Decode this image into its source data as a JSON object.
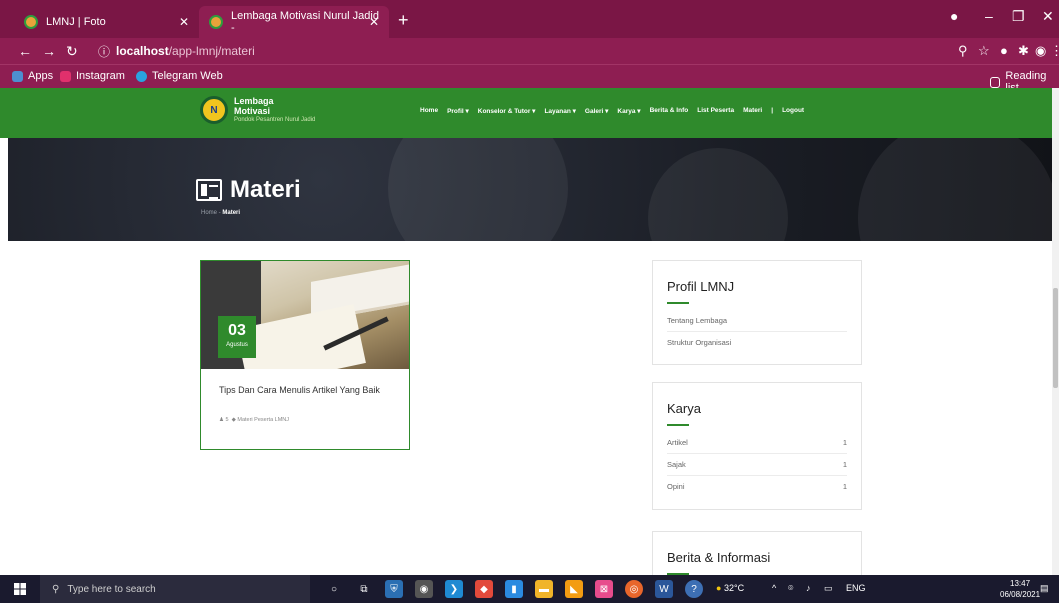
{
  "browser": {
    "tabs": [
      {
        "label": "LMNJ | Foto",
        "active": false
      },
      {
        "label": "Lembaga Motivasi Nurul Jadid - ",
        "active": true
      }
    ],
    "url_host": "localhost",
    "url_path": "/app-lmnj/materi",
    "bookmarks": [
      {
        "label": "Apps",
        "icon": "apps-grid-icon"
      },
      {
        "label": "Instagram",
        "icon": "instagram-icon"
      },
      {
        "label": "Telegram Web",
        "icon": "telegram-icon"
      }
    ],
    "reading_list": "Reading list",
    "colors": {
      "frame": "#7a1645",
      "active_tab": "#8e1e52"
    }
  },
  "site": {
    "logo": {
      "line1": "Lembaga",
      "line2": "Motivasi",
      "line3": "Pondok Pesantren Nurul Jadid"
    },
    "menu": [
      "Home",
      "Profil",
      "Konselor & Tutor",
      "Layanan",
      "Galeri",
      "Karya",
      "Berita & Info",
      "List Peserta",
      "Materi",
      "Logout"
    ],
    "menu_separator": "|",
    "accent": "#2f8a2c"
  },
  "hero": {
    "title": "Materi",
    "crumb_home": "Home",
    "crumb_current": "Materi"
  },
  "post": {
    "day": "03",
    "month": "Agustus",
    "title": "Tips Dan Cara Menulis Artikel Yang Baik",
    "meta_count": "5",
    "meta_category": "Materi Peserta LMNJ"
  },
  "sidebar": {
    "profil": {
      "title": "Profil LMNJ",
      "items": [
        "Tentang Lembaga",
        "Struktur Organisasi"
      ]
    },
    "karya": {
      "title": "Karya",
      "items": [
        {
          "label": "Artikel",
          "count": "1"
        },
        {
          "label": "Sajak",
          "count": "1"
        },
        {
          "label": "Opini",
          "count": "1"
        }
      ]
    },
    "berita": {
      "title": "Berita & Informasi"
    }
  },
  "taskbar": {
    "search_placeholder": "Type here to search",
    "weather": "32°C",
    "lang": "ENG",
    "time": "13:47",
    "date": "06/08/2021"
  }
}
